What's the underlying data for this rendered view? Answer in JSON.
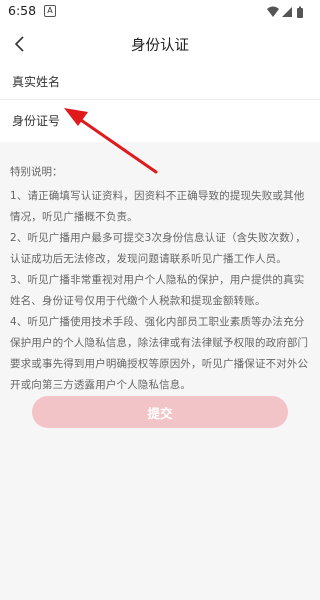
{
  "status_bar": {
    "time": "6:58",
    "notification_icon_letter": "A",
    "icons": [
      "wifi-icon",
      "signal-icon",
      "battery-icon"
    ]
  },
  "header": {
    "back_icon": "chevron-left-icon",
    "title": "身份认证"
  },
  "form": {
    "name_placeholder": "真实姓名",
    "name_value": "",
    "id_placeholder": "身份证号",
    "id_value": ""
  },
  "notes": {
    "title": "特别说明：",
    "paragraphs": [
      "1、请正确填写认证资料，因资料不正确导致的提现失败或其他情况，听见广播概不负责。",
      "2、听见广播用户最多可提交3次身份信息认证（含失败次数），认证成功后无法修改，发现问题请联系听见广播工作人员。",
      "3、听见广播非常重视对用户个人隐私的保护，用户提供的真实姓名、身份证号仅用于代缴个人税款和提现金额转账。",
      "4、听见广播使用技术手段、强化内部员工职业素质等办法充分保护用户的个人隐私信息，除法律或有法律赋予权限的政府部门要求或事先得到用户明确授权等原因外，听见广播保证不对外公开或向第三方透露用户个人隐私信息。"
    ]
  },
  "submit": {
    "label": "提交"
  },
  "colors": {
    "accent_disabled": "#f3c4c7",
    "annotation_arrow": "#e0191b",
    "background": "#f6f6f6"
  }
}
